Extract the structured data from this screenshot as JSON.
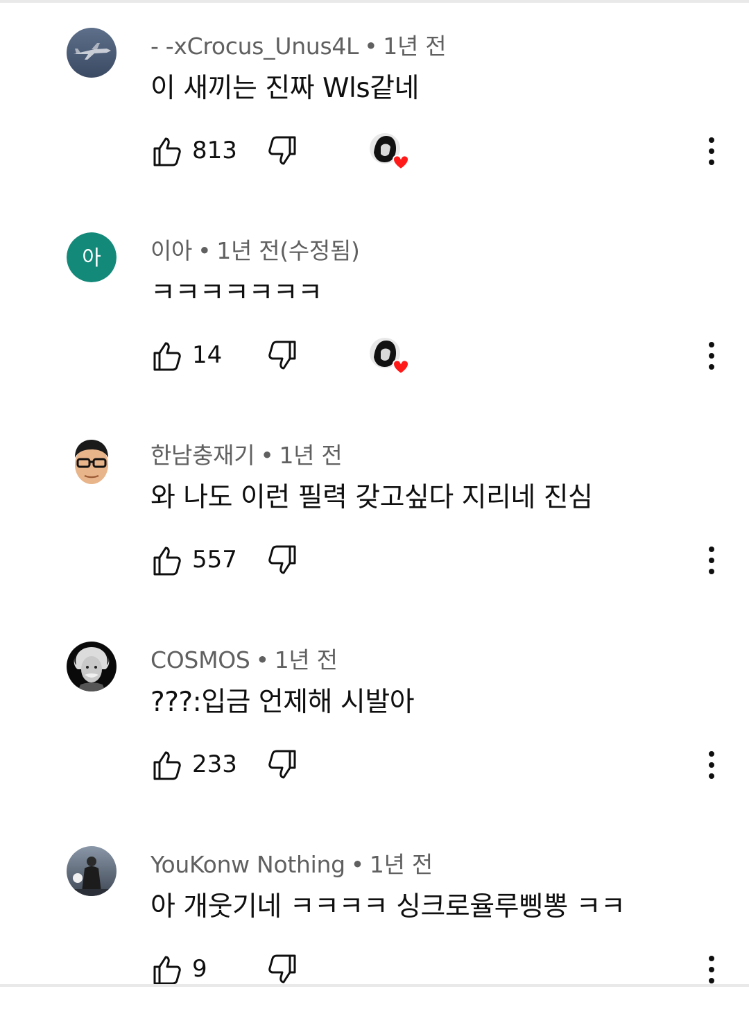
{
  "comments": [
    {
      "author": "- -xCrocus_Unus4L",
      "time": "1년 전",
      "text": "이 새끼는 진짜 Wls같네",
      "likes": "813",
      "creator_heart": true,
      "avatar_icon": "jet-fighter-avatar"
    },
    {
      "author": "이아",
      "time": "1년 전(수정됨)",
      "text": "ㅋㅋㅋㅋㅋㅋㅋ",
      "likes": "14",
      "creator_heart": true,
      "avatar_letter": "아",
      "avatar_color": "#13897a"
    },
    {
      "author": "한남충재기",
      "time": "1년 전",
      "text": "와 나도 이런 필력 갖고싶다 지리네 진심",
      "likes": "557",
      "creator_heart": false,
      "avatar_icon": "man-with-glasses-avatar"
    },
    {
      "author": "COSMOS",
      "time": "1년 전",
      "text": "???:입금 언제해 시발아",
      "likes": "233",
      "creator_heart": false,
      "avatar_icon": "einstein-portrait-avatar"
    },
    {
      "author": "YouKonw Nothing",
      "time": "1년 전",
      "text": "아 개웃기네 ㅋㅋㅋㅋ 싱크로율루삥뽕 ㅋㅋ",
      "likes": "9",
      "creator_heart": false,
      "avatar_icon": "hooded-figure-avatar"
    }
  ],
  "colors": {
    "text_primary": "#0f0f0f",
    "text_secondary": "#606060",
    "heart": "#ff1a1a"
  },
  "separator": "•"
}
